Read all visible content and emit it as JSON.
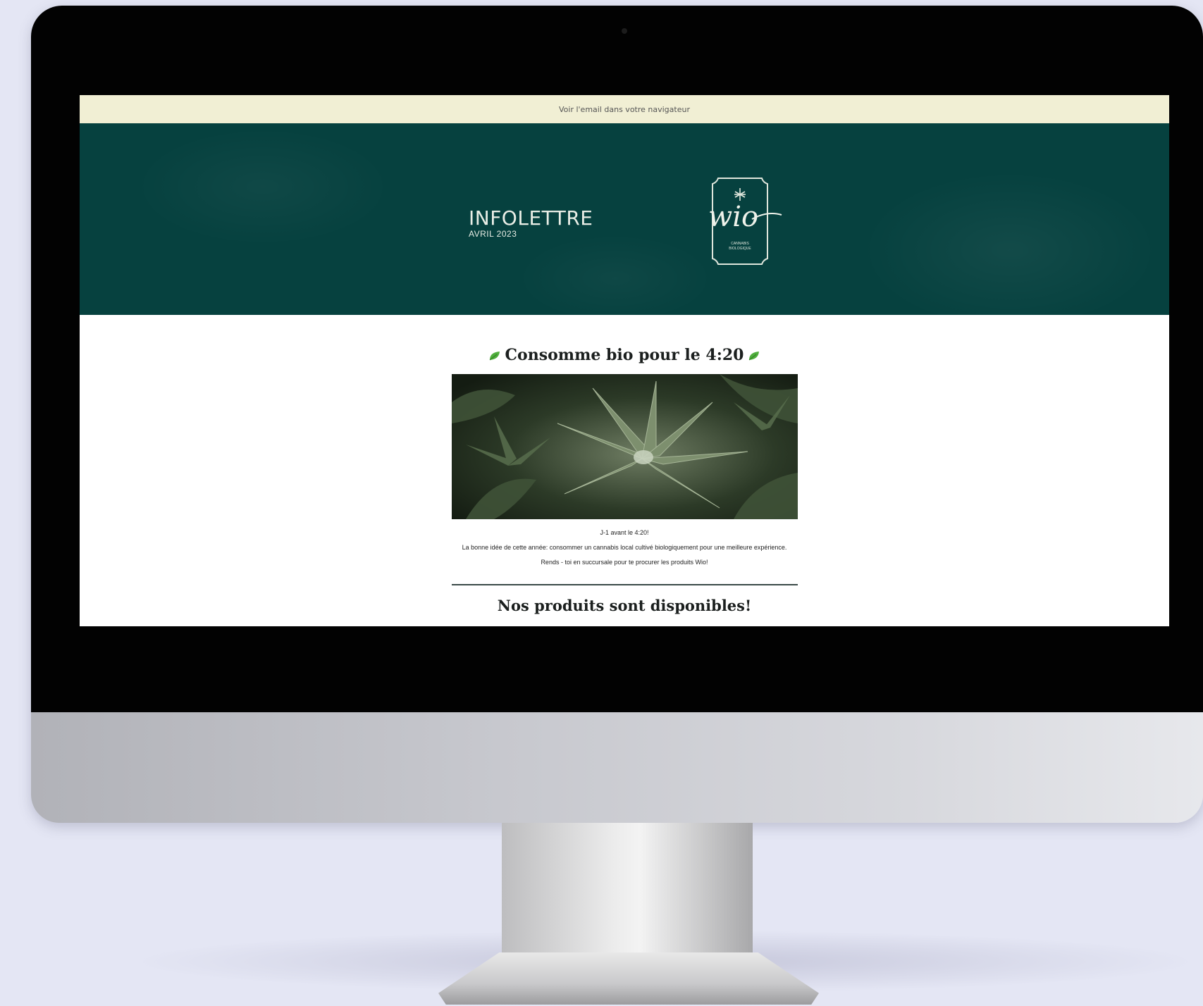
{
  "newsletter": {
    "topbar_link": "Voir l'email dans votre navigateur",
    "hero": {
      "title": "INFOLETTRE",
      "subtitle": "AVRIL 2023"
    },
    "logo": {
      "wordmark": "wio",
      "tagline_line1": "CANNABIS",
      "tagline_line2": "BIOLOGIQUE"
    },
    "section1": {
      "title": "Consomme bio pour le 4:20",
      "caption": "J-1 avant le 4:20!",
      "body": "La bonne idée de cette année: consommer un cannabis local cultivé biologiquement pour une meilleure expérience. Rends - toi en succursale pour te procurer les produits Wio!"
    },
    "section2": {
      "title": "Nos produits sont disponibles!"
    }
  },
  "colors": {
    "hero_background": "#06413f",
    "topbar_background": "#f1efd4",
    "leaf_green": "#4fae3c",
    "page_background": "#e4e6f4"
  },
  "icons": {
    "title_decoration": "leaf-icon",
    "logo_mark": "cannabis-leaf-icon"
  }
}
